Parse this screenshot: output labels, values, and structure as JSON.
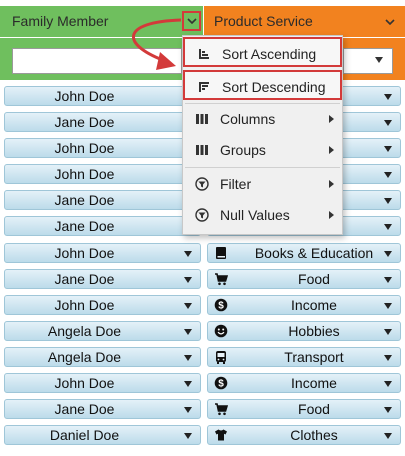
{
  "header": {
    "col1_title": "Family Member",
    "col2_title": "Product Service",
    "col1_color": "#6fbf5e",
    "col2_color": "#f2821f"
  },
  "filters": {
    "col1_value": "",
    "col2_value": ""
  },
  "menu": {
    "items": [
      {
        "label": "Sort Ascending",
        "icon": "sort-ascending-icon"
      },
      {
        "label": "Sort Descending",
        "icon": "sort-descending-icon"
      },
      {
        "label": "Columns",
        "icon": "columns-icon",
        "submenu": true
      },
      {
        "label": "Groups",
        "icon": "groups-icon",
        "submenu": true
      },
      {
        "label": "Filter",
        "icon": "filter-icon",
        "submenu": true
      },
      {
        "label": "Null Values",
        "icon": "filter-icon",
        "submenu": true
      }
    ],
    "highlight_color": "#d33a3a"
  },
  "rows": [
    {
      "member": "John Doe",
      "service": "",
      "icon": ""
    },
    {
      "member": "Jane Doe",
      "service": "",
      "icon": ""
    },
    {
      "member": "John Doe",
      "service": "",
      "icon": ""
    },
    {
      "member": "John Doe",
      "service": "",
      "icon": ""
    },
    {
      "member": "Jane Doe",
      "service": "",
      "icon": ""
    },
    {
      "member": "Jane Doe",
      "service": "",
      "icon": ""
    },
    {
      "member": "John Doe",
      "service": "Books & Education",
      "icon": "book-icon"
    },
    {
      "member": "Jane Doe",
      "service": "Food",
      "icon": "cart-icon"
    },
    {
      "member": "John Doe",
      "service": "Income",
      "icon": "dollar-icon"
    },
    {
      "member": "Angela Doe",
      "service": "Hobbies",
      "icon": "smiley-icon"
    },
    {
      "member": "Angela Doe",
      "service": "Transport",
      "icon": "bus-icon"
    },
    {
      "member": "John Doe",
      "service": "Income",
      "icon": "dollar-icon"
    },
    {
      "member": "Jane Doe",
      "service": "Food",
      "icon": "cart-icon"
    },
    {
      "member": "Daniel Doe",
      "service": "Clothes",
      "icon": "shirt-icon"
    }
  ]
}
